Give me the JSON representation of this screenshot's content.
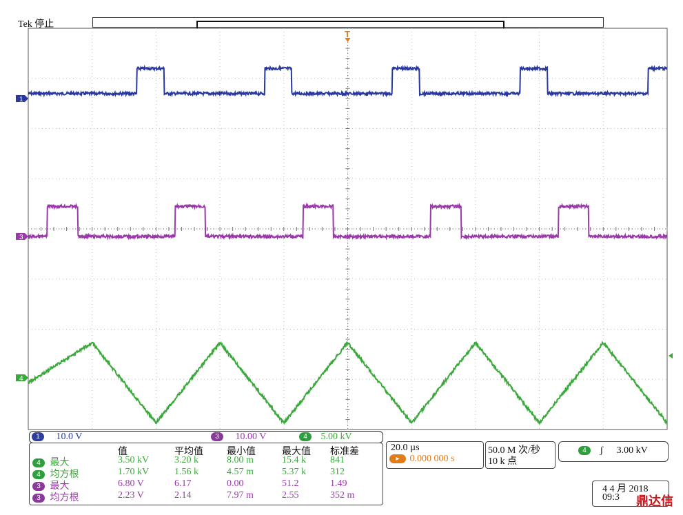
{
  "header": {
    "status": "Tek 停止"
  },
  "trigger_marker": "T",
  "channels": {
    "ch1": {
      "badge": "1",
      "scale": "10.0 V",
      "color": "#2838a0"
    },
    "ch3": {
      "badge": "3",
      "scale": "10.00 V",
      "color": "#9a3aaa"
    },
    "ch4": {
      "badge": "4",
      "scale": "5.00 kV",
      "color": "#3aa83a"
    }
  },
  "timebase": {
    "scale": "20.0 µs",
    "position": "0.000 000 s"
  },
  "acquisition": {
    "rate": "50.0 M 次/秒",
    "points": "10 k 点"
  },
  "trigger": {
    "badge": "4",
    "symbol": "ʃ",
    "level": "3.00 kV"
  },
  "datetime": {
    "date": "4 4 月 2018",
    "time": "09:3"
  },
  "logo": "鼎达信",
  "measurements": {
    "headers": [
      "值",
      "平均值",
      "最小值",
      "最大值",
      "标准差"
    ],
    "rows": [
      {
        "ch": "4",
        "name": "最大",
        "values": [
          "3.50 kV",
          "3.20 k",
          "8.00 m",
          "15.4 k",
          "841"
        ]
      },
      {
        "ch": "4",
        "name": "均方根",
        "values": [
          "1.70 kV",
          "1.56 k",
          "4.57 m",
          "5.37 k",
          "312"
        ]
      },
      {
        "ch": "3",
        "name": "最大",
        "values": [
          "6.80 V",
          "6.17",
          "0.00",
          "51.2",
          "1.49"
        ]
      },
      {
        "ch": "3",
        "name": "均方根",
        "values": [
          "2.23 V",
          "2.14",
          "7.97 m",
          "2.55",
          "352 m"
        ]
      }
    ]
  },
  "chart_data": {
    "type": "line",
    "x_divisions": 10,
    "y_divisions": 8,
    "grid": true,
    "x_unit": "µs",
    "x_per_div": 20,
    "x_range": [
      -100,
      100
    ],
    "period_us": 40,
    "series": [
      {
        "name": "1",
        "color": "#2838a0",
        "shape": "pulse",
        "low_level_div": 0.1,
        "high_level_div": 0.6,
        "pulse_start_us": [
          -66,
          -26,
          14,
          54,
          94
        ],
        "pulse_width_us": 8.5
      },
      {
        "name": "3",
        "color": "#9a3aaa",
        "shape": "pulse",
        "low_level_div": 0.0,
        "high_level_div": 0.6,
        "pulse_start_us": [
          -94,
          -54,
          -14,
          26,
          66
        ],
        "pulse_width_us": 9.5
      },
      {
        "name": "4",
        "color": "#3aa83a",
        "shape": "triangle",
        "peak_us": [
          -80,
          -40,
          0,
          40,
          80
        ],
        "trough_us": [
          -60,
          -20,
          20,
          60,
          100
        ],
        "peak_div": 0.7,
        "trough_div": -0.9
      }
    ]
  }
}
